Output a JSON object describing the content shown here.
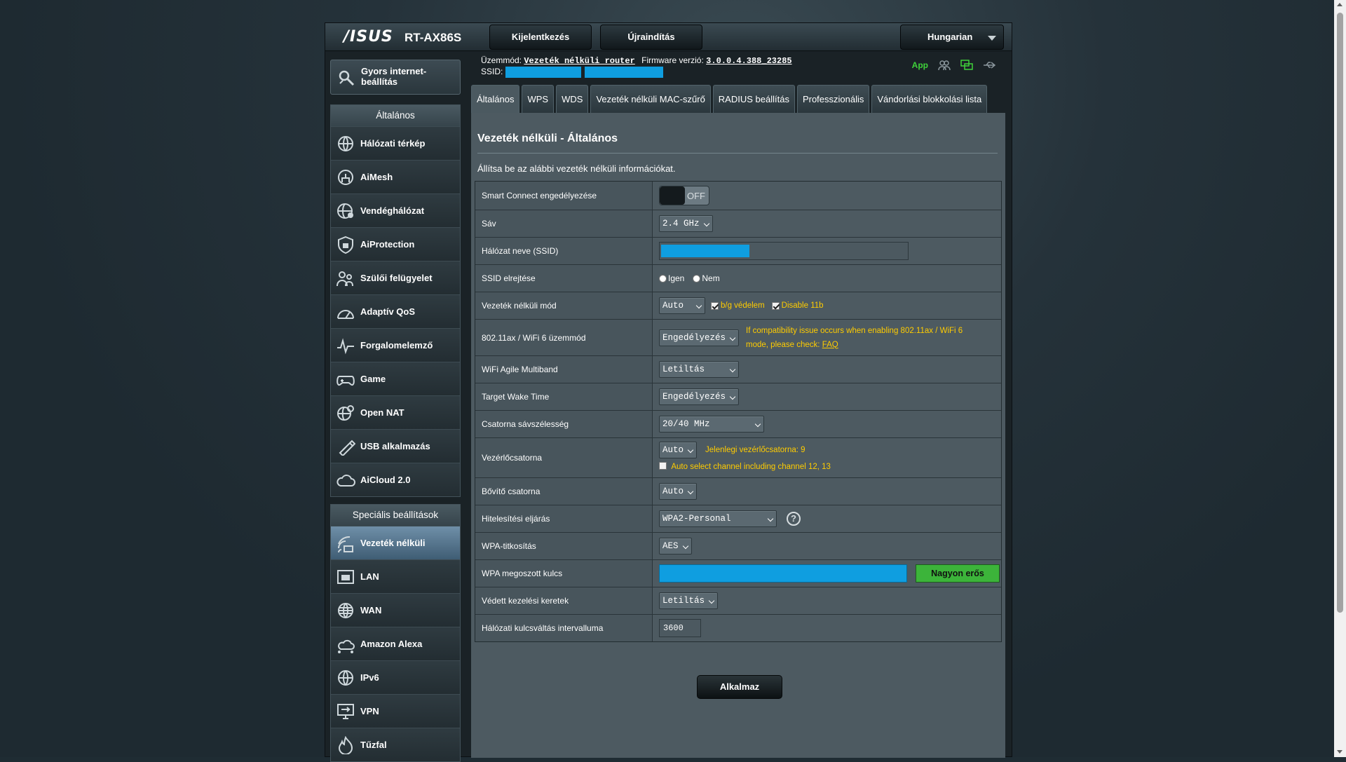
{
  "header": {
    "logo": "/ISUS",
    "model": "RT-AX86S",
    "logout_label": "Kijelentkezés",
    "reboot_label": "Újraindítás",
    "language": "Hungarian"
  },
  "status": {
    "mode_label": "Üzemmód:",
    "mode_value": "Vezeték nélküli router",
    "firmware_label": "Firmware verzió:",
    "firmware_value": "3.0.0.4.388_23285",
    "ssid_label": "SSID:",
    "app_label": "App"
  },
  "sidebar": {
    "quick_setup": "Gyors internet-beállítás",
    "general_title": "Általános",
    "general_items": [
      {
        "label": "Hálózati térkép",
        "icon": "network-map-icon"
      },
      {
        "label": "AiMesh",
        "icon": "aimesh-icon"
      },
      {
        "label": "Vendéghálózat",
        "icon": "guest-network-icon"
      },
      {
        "label": "AiProtection",
        "icon": "aiprotection-icon"
      },
      {
        "label": "Szülői felügyelet",
        "icon": "parental-control-icon"
      },
      {
        "label": "Adaptív QoS",
        "icon": "qos-icon"
      },
      {
        "label": "Forgalomelemző",
        "icon": "traffic-analyzer-icon"
      },
      {
        "label": "Game",
        "icon": "game-icon"
      },
      {
        "label": "Open NAT",
        "icon": "open-nat-icon"
      },
      {
        "label": "USB alkalmazás",
        "icon": "usb-app-icon"
      },
      {
        "label": "AiCloud 2.0",
        "icon": "aicloud-icon"
      }
    ],
    "advanced_title": "Speciális beállítások",
    "advanced_items": [
      {
        "label": "Vezeték nélküli",
        "icon": "wireless-icon"
      },
      {
        "label": "LAN",
        "icon": "lan-icon"
      },
      {
        "label": "WAN",
        "icon": "wan-icon"
      },
      {
        "label": "Amazon Alexa",
        "icon": "alexa-icon"
      },
      {
        "label": "IPv6",
        "icon": "ipv6-icon"
      },
      {
        "label": "VPN",
        "icon": "vpn-icon"
      },
      {
        "label": "Tűzfal",
        "icon": "firewall-icon"
      }
    ]
  },
  "tabs": [
    "Általános",
    "WPS",
    "WDS",
    "Vezeték nélküli MAC-szűrő",
    "RADIUS beállítás",
    "Professzionális",
    "Vándorlási blokkolási lista"
  ],
  "page": {
    "title": "Vezeték nélküli - Általános",
    "description": "Állítsa be az alábbi vezeték nélküli információkat."
  },
  "form": {
    "smart_connect": {
      "label": "Smart Connect engedélyezése",
      "value": "OFF"
    },
    "band": {
      "label": "Sáv",
      "value": "2.4 GHz"
    },
    "ssid": {
      "label": "Hálózat neve (SSID)"
    },
    "hide_ssid": {
      "label": "SSID elrejtése",
      "yes": "Igen",
      "no": "Nem"
    },
    "wireless_mode": {
      "label": "Vezeték nélküli mód",
      "value": "Auto",
      "bg_protection": "b/g védelem",
      "disable_11b": "Disable 11b"
    },
    "ax_mode": {
      "label": "802.11ax / WiFi 6 üzemmód",
      "value": "Engedélyezés",
      "hint": "If compatibility issue occurs when enabling 802.11ax / WiFi 6 mode, please check:",
      "faq": "FAQ"
    },
    "agile_multiband": {
      "label": "WiFi Agile Multiband",
      "value": "Letiltás"
    },
    "twt": {
      "label": "Target Wake Time",
      "value": "Engedélyezés"
    },
    "bandwidth": {
      "label": "Csatorna sávszélesség",
      "value": "20/40 MHz"
    },
    "control_channel": {
      "label": "Vezérlőcsatorna",
      "value": "Auto",
      "current": "Jelenlegi vezérlőcsatorna: 9",
      "auto_select": "Auto select channel including channel 12, 13"
    },
    "extension_channel": {
      "label": "Bővítő csatorna",
      "value": "Auto"
    },
    "auth_method": {
      "label": "Hitelesítési eljárás",
      "value": "WPA2-Personal"
    },
    "wpa_encryption": {
      "label": "WPA-titkosítás",
      "value": "AES"
    },
    "wpa_key": {
      "label": "WPA megoszott kulcs",
      "strength": "Nagyon erős"
    },
    "pmf": {
      "label": "Védett kezelési keretek",
      "value": "Letiltás"
    },
    "rekey": {
      "label": "Hálózati kulcsváltás intervalluma",
      "value": "3600"
    }
  },
  "apply_label": "Alkalmaz",
  "colors": {
    "accent_blue": "#0f9ee0",
    "hint_yellow": "#ffcc00",
    "strength_green": "#3cb43a",
    "app_green": "#3fd23a"
  }
}
